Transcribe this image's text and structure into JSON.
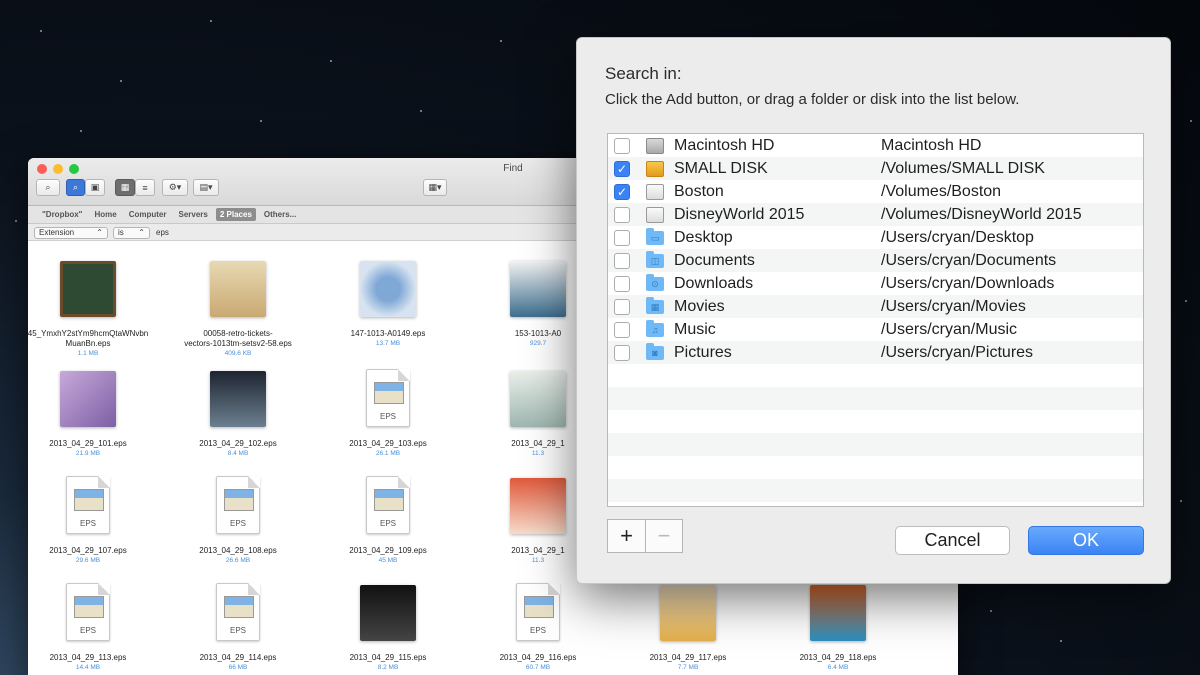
{
  "finder": {
    "title": "Find",
    "tabs": [
      "\"Dropbox\"",
      "Home",
      "Computer",
      "Servers",
      "2 Places",
      "Others..."
    ],
    "active_tab": 4,
    "criteria": {
      "field": "Extension",
      "operator": "is",
      "value": "eps"
    },
    "files": [
      {
        "name": "45_YmxhY2stYm9hcmQtaWNvbn",
        "name2": "MuanBn.eps",
        "size": "1.1 MB",
        "kind": "blackboard"
      },
      {
        "name": "00058-retro-tickets-",
        "name2": "vectors-1013tm-setsv2-58.eps",
        "size": "409.6 KB",
        "kind": "tickets"
      },
      {
        "name": "147-1013-A0149.eps",
        "name2": "",
        "size": "13.7 MB",
        "kind": "globe"
      },
      {
        "name": "153-1013-A0",
        "name2": "",
        "size": "929.7",
        "kind": "ribbons"
      },
      {
        "name": "2013_04_29_101.eps",
        "name2": "",
        "size": "21.9 MB",
        "kind": "summer"
      },
      {
        "name": "2013_04_29_102.eps",
        "name2": "",
        "size": "8.4 MB",
        "kind": "escape"
      },
      {
        "name": "2013_04_29_103.eps",
        "name2": "",
        "size": "26.1 MB",
        "kind": "eps"
      },
      {
        "name": "2013_04_29_1",
        "name2": "",
        "size": "11.3",
        "kind": "city"
      },
      {
        "name": "2013_04_29_107.eps",
        "name2": "",
        "size": "29.6 MB",
        "kind": "eps"
      },
      {
        "name": "2013_04_29_108.eps",
        "name2": "",
        "size": "26.6 MB",
        "kind": "eps"
      },
      {
        "name": "2013_04_29_109.eps",
        "name2": "",
        "size": "45 MB",
        "kind": "eps"
      },
      {
        "name": "2013_04_29_1",
        "name2": "",
        "size": "11.3",
        "kind": "sale"
      },
      {
        "name": "2013_04_29_113.eps",
        "name2": "",
        "size": "14.4 MB",
        "kind": "eps"
      },
      {
        "name": "2013_04_29_114.eps",
        "name2": "",
        "size": "66 MB",
        "kind": "eps"
      },
      {
        "name": "2013_04_29_115.eps",
        "name2": "",
        "size": "8.2 MB",
        "kind": "beach"
      },
      {
        "name": "2013_04_29_116.eps",
        "name2": "",
        "size": "60.7 MB",
        "kind": "eps"
      },
      {
        "name": "2013_04_29_117.eps",
        "name2": "",
        "size": "7.7 MB",
        "kind": "summersale"
      },
      {
        "name": "2013_04_29_118.eps",
        "name2": "",
        "size": "6.4 MB",
        "kind": "sunset"
      }
    ],
    "eps_label": "EPS"
  },
  "dialog": {
    "title": "Search in:",
    "subtitle": "Click the Add button, or drag a folder or disk into the list below.",
    "locations": [
      {
        "name": "Macintosh HD",
        "path": "Macintosh HD",
        "checked": false,
        "icon": "hard-disk-icon"
      },
      {
        "name": "SMALL DISK",
        "path": "/Volumes/SMALL DISK",
        "checked": true,
        "icon": "external-disk-icon"
      },
      {
        "name": "Boston",
        "path": "/Volumes/Boston",
        "checked": true,
        "icon": "white-disk-icon"
      },
      {
        "name": "DisneyWorld 2015",
        "path": "/Volumes/DisneyWorld 2015",
        "checked": false,
        "icon": "white-disk-icon"
      },
      {
        "name": "Desktop",
        "path": "/Users/cryan/Desktop",
        "checked": false,
        "icon": "desktop-folder-icon"
      },
      {
        "name": "Documents",
        "path": "/Users/cryan/Documents",
        "checked": false,
        "icon": "documents-folder-icon"
      },
      {
        "name": "Downloads",
        "path": "/Users/cryan/Downloads",
        "checked": false,
        "icon": "downloads-folder-icon"
      },
      {
        "name": "Movies",
        "path": "/Users/cryan/Movies",
        "checked": false,
        "icon": "movies-folder-icon"
      },
      {
        "name": "Music",
        "path": "/Users/cryan/Music",
        "checked": false,
        "icon": "music-folder-icon"
      },
      {
        "name": "Pictures",
        "path": "/Users/cryan/Pictures",
        "checked": false,
        "icon": "pictures-folder-icon"
      }
    ],
    "add_label": "+",
    "remove_label": "−",
    "cancel_label": "Cancel",
    "ok_label": "OK"
  }
}
